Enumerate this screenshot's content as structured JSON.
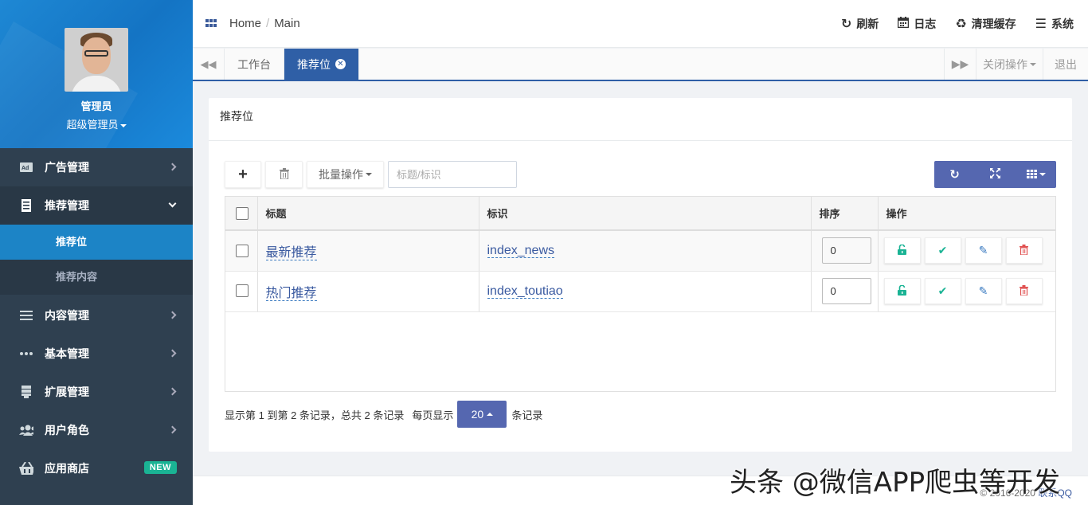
{
  "profile": {
    "name": "管理员",
    "role": "超级管理员"
  },
  "sidebar": {
    "items": [
      {
        "label": "广告管理",
        "icon": "ad-icon"
      },
      {
        "label": "推荐管理",
        "icon": "list-icon"
      },
      {
        "label": "内容管理",
        "icon": "menu-icon"
      },
      {
        "label": "基本管理",
        "icon": "dots-icon"
      },
      {
        "label": "扩展管理",
        "icon": "stack-icon"
      },
      {
        "label": "用户角色",
        "icon": "users-icon"
      },
      {
        "label": "应用商店",
        "icon": "basket-icon",
        "badge": "NEW"
      }
    ],
    "sub": [
      "推荐位",
      "推荐内容"
    ]
  },
  "breadcrumb": {
    "home": "Home",
    "current": "Main"
  },
  "top_actions": {
    "refresh": "刷新",
    "log": "日志",
    "clear_cache": "清理缓存",
    "system": "系统"
  },
  "tabs": {
    "items": [
      "工作台",
      "推荐位"
    ],
    "close_ops": "关闭操作",
    "logout": "退出"
  },
  "panel": {
    "title": "推荐位"
  },
  "toolbar": {
    "batch": "批量操作",
    "search_placeholder": "标题/标识"
  },
  "table": {
    "headers": [
      "标题",
      "标识",
      "排序",
      "操作"
    ],
    "rows": [
      {
        "title": "最新推荐",
        "key": "index_news",
        "sort": "0"
      },
      {
        "title": "热门推荐",
        "key": "index_toutiao",
        "sort": "0"
      }
    ]
  },
  "pager": {
    "info": "显示第 1 到第 2 条记录，总共 2 条记录",
    "per_page_prefix": "每页显示",
    "per_page": "20",
    "per_page_suffix": "条记录"
  },
  "footer": {
    "copyright": "© 2016-2020",
    "contact": "联系QQ"
  },
  "watermark": "头条 @微信APP爬虫等开发",
  "colors": {
    "sidebar": "#2f4050",
    "accent": "#1c84c6",
    "tab_active": "#2f5fa6",
    "btn_primary": "#5567b0",
    "success": "#1ab394",
    "danger": "#e05050"
  }
}
